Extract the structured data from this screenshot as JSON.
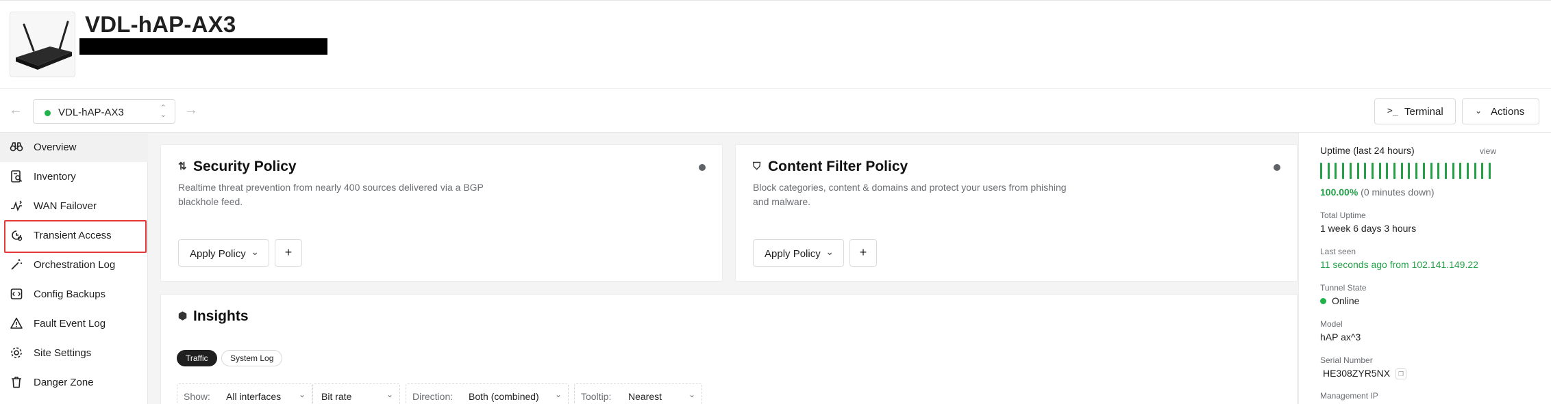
{
  "header": {
    "device_title": "VDL-hAP-AX3"
  },
  "toolbar": {
    "device_selector": "VDL-hAP-AX3",
    "terminal_label": "Terminal",
    "actions_label": "Actions"
  },
  "sidebar": {
    "items": [
      {
        "label": "Overview",
        "icon": "binoculars-icon"
      },
      {
        "label": "Inventory",
        "icon": "inventory-icon"
      },
      {
        "label": "WAN Failover",
        "icon": "failover-icon"
      },
      {
        "label": "Transient Access",
        "icon": "transient-access-icon"
      },
      {
        "label": "Orchestration Log",
        "icon": "wand-icon"
      },
      {
        "label": "Config Backups",
        "icon": "backup-icon"
      },
      {
        "label": "Fault Event Log",
        "icon": "warning-icon"
      },
      {
        "label": "Site Settings",
        "icon": "gear-icon"
      },
      {
        "label": "Danger Zone",
        "icon": "trash-icon"
      }
    ]
  },
  "security_policy": {
    "title": "Security Policy",
    "description": "Realtime threat prevention from nearly 400 sources delivered via a BGP blackhole feed.",
    "apply_label": "Apply Policy",
    "add_label": "+"
  },
  "content_filter": {
    "title": "Content Filter Policy",
    "description": "Block categories, content & domains and protect your users from phishing and malware.",
    "apply_label": "Apply Policy",
    "add_label": "+"
  },
  "insights": {
    "title": "Insights",
    "tabs": [
      "Traffic",
      "System Log"
    ],
    "filters": {
      "show_label": "Show:",
      "show_value": "All interfaces",
      "metric_value": "Bit rate",
      "direction_label": "Direction:",
      "direction_value": "Both (combined)",
      "tooltip_label": "Tooltip:",
      "tooltip_value": "Nearest"
    }
  },
  "info": {
    "uptime_label": "Uptime (last 24 hours)",
    "view_link": "view",
    "uptime_percent": "100.00%",
    "uptime_down": "(0 minutes down)",
    "total_uptime_label": "Total Uptime",
    "total_uptime_value": "1 week 6 days 3 hours",
    "last_seen_label": "Last seen",
    "last_seen_value": "11 seconds ago from 102.141.149.22",
    "tunnel_state_label": "Tunnel State",
    "tunnel_state_value": "Online",
    "model_label": "Model",
    "model_value": "hAP ax^3",
    "serial_label": "Serial Number",
    "serial_value": "HE308ZYR5NX",
    "mgmt_ip_label": "Management IP"
  },
  "colors": {
    "online_green": "#22b24c",
    "uptime_green": "#24a148",
    "highlight_red": "#e53935"
  }
}
